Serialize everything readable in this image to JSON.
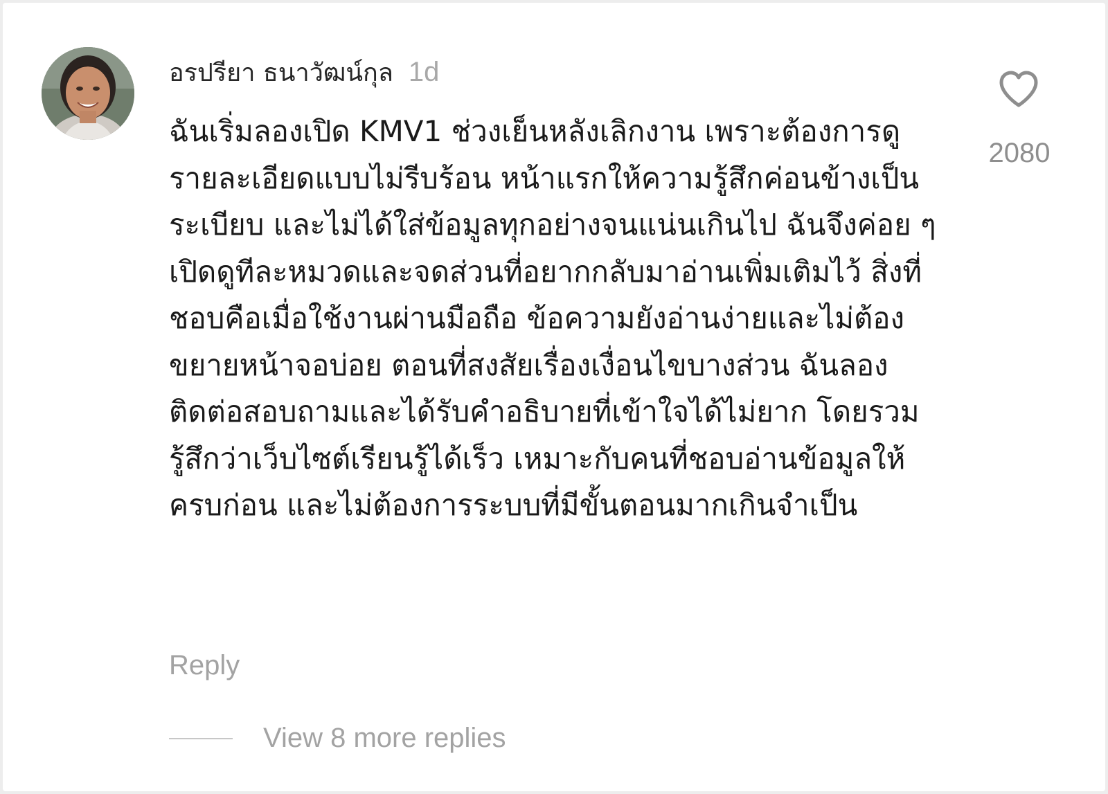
{
  "comment": {
    "author": "อรปรียา ธนาวัฒน์กุล",
    "timestamp": "1d",
    "text": "ฉันเริ่มลองเปิด KMV1 ช่วงเย็นหลังเลิกงาน เพราะต้องการดูรายละเอียดแบบไม่รีบร้อน หน้าแรกให้ความรู้สึกค่อนข้างเป็นระเบียบ และไม่ได้ใส่ข้อมูลทุกอย่างจนแน่นเกินไป ฉันจึงค่อย ๆ เปิดดูทีละหมวดและจดส่วนที่อยากกลับมาอ่านเพิ่มเติมไว้ สิ่งที่ชอบคือเมื่อใช้งานผ่านมือถือ ข้อความยังอ่านง่ายและไม่ต้องขยายหน้าจอบ่อย ตอนที่สงสัยเรื่องเงื่อนไขบางส่วน ฉันลองติดต่อสอบถามและได้รับคำอธิบายที่เข้าใจได้ไม่ยาก โดยรวมรู้สึกว่าเว็บไซต์เรียนรู้ได้เร็ว เหมาะกับคนที่ชอบอ่านข้อมูลให้ครบก่อน และไม่ต้องการระบบที่มีขั้นตอนมากเกินจำเป็น",
    "like_count": "2080",
    "like_icon": "heart-outline-icon",
    "reply_label": "Reply",
    "view_replies_label": "View 8 more replies"
  },
  "colors": {
    "text": "#1a1a1a",
    "muted": "#a3a3a3",
    "like_icon": "#8e8e8e"
  }
}
